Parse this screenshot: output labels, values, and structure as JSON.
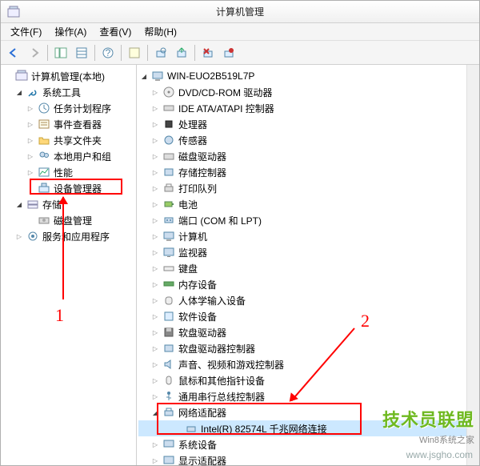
{
  "window": {
    "title": "计算机管理"
  },
  "menu": {
    "file": "文件(F)",
    "action": "操作(A)",
    "view": "查看(V)",
    "help": "帮助(H)"
  },
  "left_tree": {
    "root": "计算机管理(本地)",
    "system_tools": {
      "label": "系统工具",
      "children": {
        "task_scheduler": "任务计划程序",
        "event_viewer": "事件查看器",
        "shared_folders": "共享文件夹",
        "local_users": "本地用户和组",
        "performance": "性能",
        "device_manager": "设备管理器"
      }
    },
    "storage": {
      "label": "存储",
      "disk_mgmt": "磁盘管理"
    },
    "services": "服务和应用程序"
  },
  "right_tree": {
    "root": "WIN-EUO2B519L7P",
    "items": {
      "dvd": "DVD/CD-ROM 驱动器",
      "ide": "IDE ATA/ATAPI 控制器",
      "cpu": "处理器",
      "sensor": "传感器",
      "disk": "磁盘驱动器",
      "storage_ctrl": "存储控制器",
      "print_queue": "打印队列",
      "battery": "电池",
      "ports": "端口 (COM 和 LPT)",
      "computer": "计算机",
      "monitor": "监视器",
      "keyboard": "键盘",
      "memory": "内存设备",
      "hid": "人体学输入设备",
      "software_dev": "软件设备",
      "floppy": "软盘驱动器",
      "floppy_ctrl": "软盘驱动器控制器",
      "sound": "声音、视频和游戏控制器",
      "mouse": "鼠标和其他指针设备",
      "usb": "通用串行总线控制器",
      "network": "网络适配器",
      "network_item": "Intel(R) 82574L 千兆网络连接",
      "system_dev": "系统设备",
      "display": "显示适配器"
    }
  },
  "annotations": {
    "one": "1",
    "two": "2"
  },
  "watermark": {
    "brand": "技术员联盟",
    "sub": "Win8系统之家",
    "url": "www.jsgho.com"
  }
}
